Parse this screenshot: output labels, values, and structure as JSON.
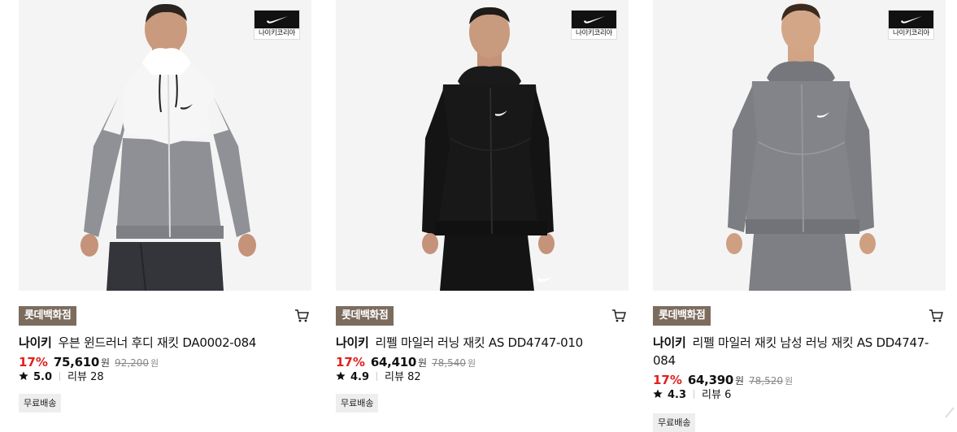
{
  "products": [
    {
      "badge_text": "나이키코리아",
      "store": "롯데백화점",
      "brand": "나이키",
      "name": "우븐 윈드러너 후디 재킷 DA0002-084",
      "discount": "17%",
      "price": "75,610",
      "currency": "원",
      "original_price": "92,200",
      "rating": "5.0",
      "reviews": "리뷰 28",
      "shipping": "무료배송"
    },
    {
      "badge_text": "나이키코리아",
      "store": "롯데백화점",
      "brand": "나이키",
      "name": "리펠 마일러 러닝 재킷 AS DD4747-010",
      "discount": "17%",
      "price": "64,410",
      "currency": "원",
      "original_price": "78,540",
      "rating": "4.9",
      "reviews": "리뷰 82",
      "shipping": "무료배송"
    },
    {
      "badge_text": "나이키코리아",
      "store": "롯데백화점",
      "brand": "나이키",
      "name": "리펠 마일러 재킷 남성 러닝 재킷 AS DD4747-084",
      "discount": "17%",
      "price": "64,390",
      "currency": "원",
      "original_price": "78,520",
      "rating": "4.3",
      "reviews": "리뷰 6",
      "shipping": "무료배송"
    }
  ],
  "icons": {
    "cart": "cart-icon",
    "star": "star-icon",
    "brand_logo": "nike-swoosh-icon"
  },
  "colors": {
    "discount": "#e0201f",
    "store_tag_bg": "#7c6c5e",
    "ship_tag_bg": "#eeeeee",
    "image_bg": "#f4f4f4"
  }
}
